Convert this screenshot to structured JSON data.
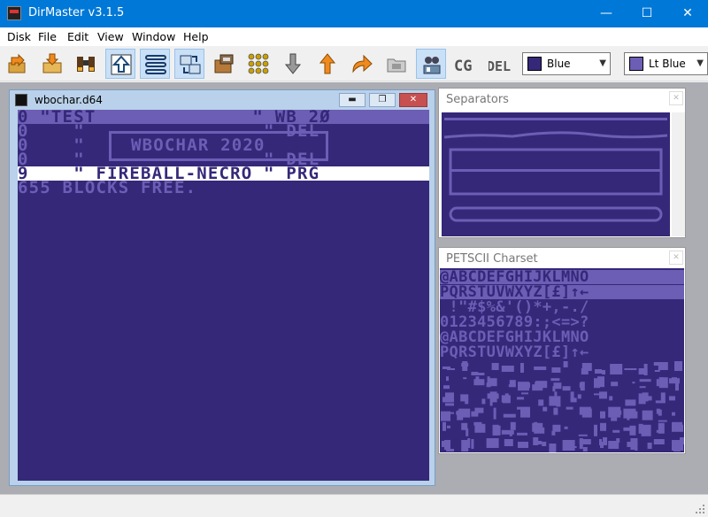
{
  "app": {
    "title": "DirMaster v3.1.5"
  },
  "window_controls": {
    "minimize": "—",
    "maximize": "☐",
    "close": "✕"
  },
  "menu": [
    "Disk",
    "File",
    "Edit",
    "View",
    "Window",
    "Help"
  ],
  "toolbar": {
    "buttons": [
      "import-icon",
      "export-icon",
      "binoculars-icon",
      "c64-logo-icon",
      "separator-icon",
      "swap-icon",
      "packages-icon",
      "dots-grid-icon",
      "down-arrow-icon",
      "up-arrow-icon",
      "redo-arrow-icon",
      "folder-icon",
      "network-users-icon",
      "cg-icon",
      "del-icon"
    ],
    "cg_label": "CG",
    "del_label": "DEL"
  },
  "color_selects": [
    {
      "label": "Blue",
      "color": "#352879"
    },
    {
      "label": "Lt Blue",
      "color": "#6c5eb5"
    }
  ],
  "document_window": {
    "title": "wbochar.d64",
    "header_row": "0 \"TEST              \" WB 2Ø",
    "rows": [
      {
        "blocks": "0",
        "name": "\"WBOCHAR 2020\"",
        "type": "DEL"
      },
      {
        "blocks": "0",
        "name": "",
        "type": "DEL"
      },
      {
        "blocks": "0",
        "name": "",
        "type": "DEL"
      },
      {
        "blocks": "9",
        "name": "\" FIREBALL-NECRO \"",
        "type": "PRG"
      }
    ],
    "row_lines": [
      "0    \"                \" DEL",
      "0    \"                \" DEL",
      "0    \"                \" DEL",
      "9    \" FIREBALL-NECRO \" PRG"
    ],
    "logo_text": "WBOCHAR 2020",
    "free_line": "655 BLOCKS FREE."
  },
  "panels": {
    "separators": {
      "title": "Separators"
    },
    "charset": {
      "title": "PETSCII Charset",
      "lines": [
        "@ABCDEFGHIJKLMNO",
        "PQRSTUVWXYZ[£]↑←",
        " !\"#$%&'()*+,-./",
        "0123456789:;<=>?",
        "@ABCDEFGHIJKLMNO",
        "PQRSTUVWXYZ[£]↑←"
      ]
    }
  },
  "colors": {
    "c64_dark": "#352879",
    "c64_light": "#6c5eb5",
    "titlebar": "#0078d7",
    "mdi_bg": "#abadb3"
  }
}
